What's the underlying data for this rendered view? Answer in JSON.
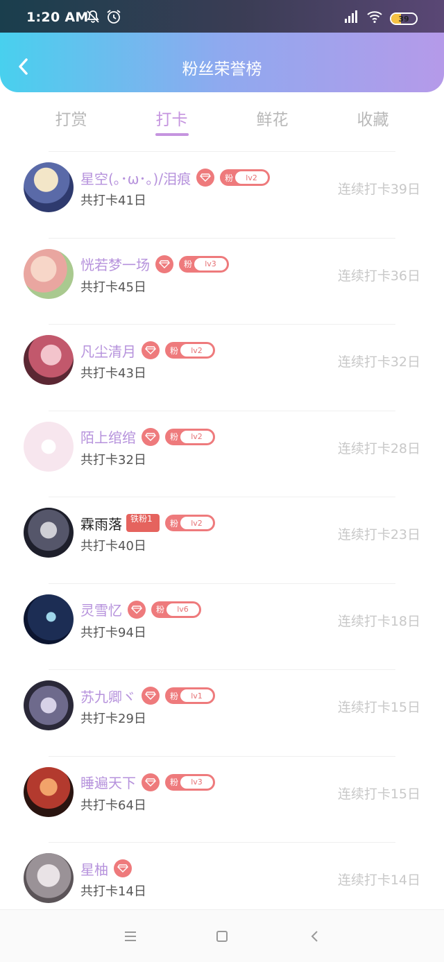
{
  "status_bar": {
    "time": "1:20 AM",
    "battery": "39",
    "icons": [
      "mute-icon",
      "alarm-icon",
      "signal-icon",
      "wifi-icon",
      "battery-icon"
    ]
  },
  "header": {
    "title": "粉丝荣誉榜",
    "back_icon": "chevron-left-icon"
  },
  "tabs": [
    {
      "label": "打赏",
      "active": false
    },
    {
      "label": "打卡",
      "active": true
    },
    {
      "label": "鲜花",
      "active": false
    },
    {
      "label": "收藏",
      "active": false
    }
  ],
  "colors": {
    "accent": "#c594df",
    "badge": "#ee7a7c",
    "name": "#b692dc"
  },
  "fan_badge_label": "粉",
  "entries": [
    {
      "name": "星空(｡･ω･｡)/泪痕",
      "total": "共打卡41日",
      "streak": "连续打卡39日",
      "level": "lv2",
      "gem": true,
      "fan": true,
      "iron": null,
      "dark": false
    },
    {
      "name": "恍若梦一场",
      "total": "共打卡45日",
      "streak": "连续打卡36日",
      "level": "lv3",
      "gem": true,
      "fan": true,
      "iron": null,
      "dark": false
    },
    {
      "name": "凡尘清月",
      "total": "共打卡43日",
      "streak": "连续打卡32日",
      "level": "lv2",
      "gem": true,
      "fan": true,
      "iron": null,
      "dark": false
    },
    {
      "name": "陌上绾绾",
      "total": "共打卡32日",
      "streak": "连续打卡28日",
      "level": "lv2",
      "gem": true,
      "fan": true,
      "iron": null,
      "dark": false
    },
    {
      "name": "霖雨落",
      "total": "共打卡40日",
      "streak": "连续打卡23日",
      "level": "lv2",
      "gem": false,
      "fan": true,
      "iron": "铁粉1",
      "dark": true
    },
    {
      "name": "灵雪忆",
      "total": "共打卡94日",
      "streak": "连续打卡18日",
      "level": "lv6",
      "gem": true,
      "fan": true,
      "iron": null,
      "dark": false
    },
    {
      "name": "苏九卿ヾ",
      "total": "共打卡29日",
      "streak": "连续打卡15日",
      "level": "lv1",
      "gem": true,
      "fan": true,
      "iron": null,
      "dark": false
    },
    {
      "name": "睡遍天下",
      "total": "共打卡64日",
      "streak": "连续打卡15日",
      "level": "lv3",
      "gem": true,
      "fan": true,
      "iron": null,
      "dark": false
    },
    {
      "name": "星柚",
      "total": "共打卡14日",
      "streak": "连续打卡14日",
      "level": null,
      "gem": true,
      "fan": false,
      "iron": null,
      "dark": false
    }
  ],
  "nav": [
    {
      "icon": "menu-icon"
    },
    {
      "icon": "home-square-icon"
    },
    {
      "icon": "back-triangle-icon"
    }
  ]
}
